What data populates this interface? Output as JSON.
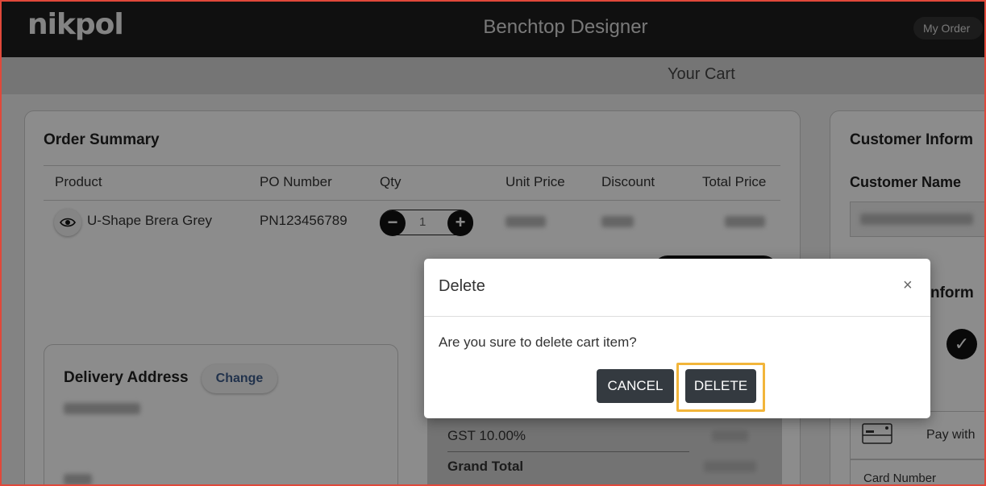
{
  "header": {
    "logo": "nikpol",
    "app_title": "Benchtop Designer",
    "my_order_label": "My Order"
  },
  "subbar": {
    "title": "Your Cart"
  },
  "order_summary": {
    "title": "Order Summary",
    "columns": [
      "Product",
      "PO Number",
      "Qty",
      "Unit Price",
      "Discount",
      "Total Price"
    ],
    "row": {
      "product": "U-Shape Brera Grey",
      "po_number": "PN123456789",
      "qty": "1"
    }
  },
  "delivery": {
    "title": "Delivery Address",
    "change_label": "Change"
  },
  "totals": {
    "gst_label": "GST 10.00%",
    "grand_total_label": "Grand Total"
  },
  "customer": {
    "title": "Customer Inform",
    "name_label": "Customer Name",
    "section2_title": "nform",
    "pay_label": "Pay with",
    "card_number_label": "Card Number"
  },
  "modal": {
    "title": "Delete",
    "close_glyph": "×",
    "message": "Are you sure to delete cart item?",
    "cancel_label": "CANCEL",
    "delete_label": "DELETE"
  },
  "colors": {
    "header_bg": "#1e1e1e",
    "button_bg": "#343a40",
    "highlight": "#f2b53a",
    "accent_link": "#3d5c8a"
  }
}
